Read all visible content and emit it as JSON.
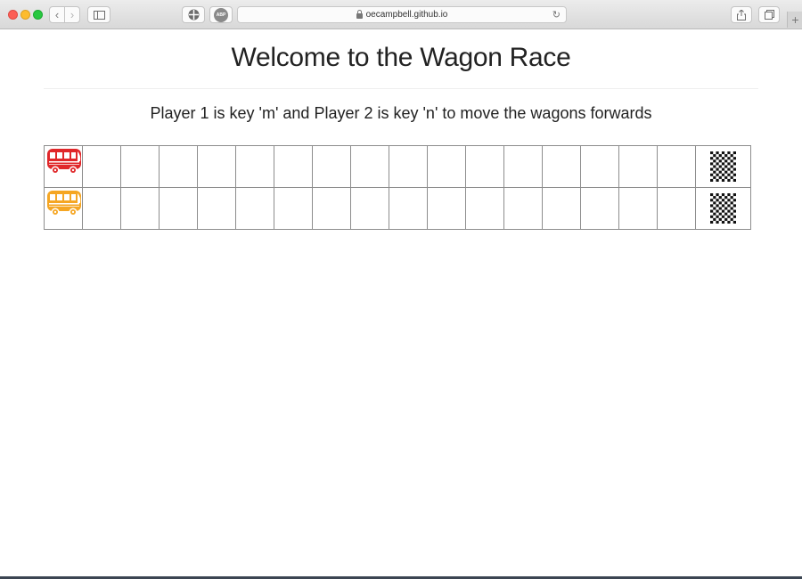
{
  "browser": {
    "url": "oecampbell.github.io",
    "abp_label": "ABP"
  },
  "page": {
    "title": "Welcome to the Wagon Race",
    "instructions": "Player 1 is key 'm' and Player 2 is key 'n' to move the wagons forwards"
  },
  "race": {
    "track_cells": 17,
    "players": [
      {
        "name": "Player 1",
        "wagon_color": "#e0272a",
        "position": 0
      },
      {
        "name": "Player 2",
        "wagon_color": "#f5a623",
        "position": 0
      }
    ]
  },
  "icons": {
    "wagon": "bus-icon",
    "finish": "checkered-flag-icon"
  }
}
